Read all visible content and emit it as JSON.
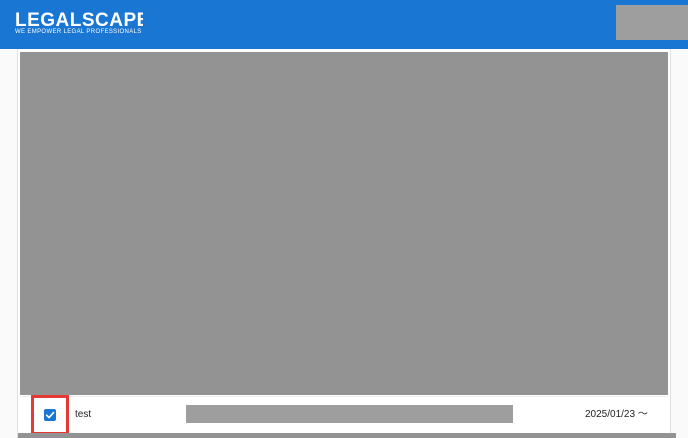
{
  "header": {
    "brand_name": "LEGALSCAPE",
    "brand_tagline": "WE EMPOWER LEGAL PROFESSIONALS",
    "colors": {
      "header_bg": "#1976d2",
      "brand_text": "#ffffff"
    }
  },
  "row": {
    "checked": true,
    "name": "test",
    "date": "2025/01/23 〜"
  },
  "icons": {
    "checkbox": "checkbox-checked-icon"
  },
  "colors": {
    "accent": "#1976d2",
    "highlight": "#e53935",
    "redaction": "#939393"
  }
}
